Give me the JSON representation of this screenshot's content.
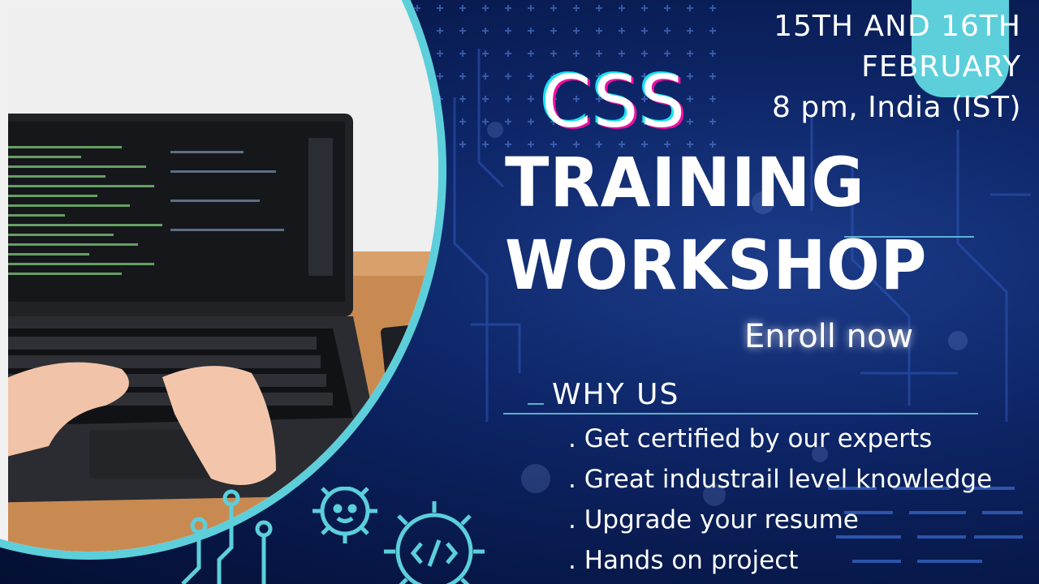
{
  "event": {
    "title_line1": "CSS",
    "title_line2": "TRAINING",
    "title_line3": "WORKSHOP"
  },
  "schedule": {
    "line1": "15TH AND 16TH",
    "line2": "FEBRUARY",
    "line3": "8 pm, India (IST)"
  },
  "cta": {
    "enroll_label": "Enroll now"
  },
  "why_us": {
    "heading": "WHY US",
    "items": [
      ". Get certified by our experts",
      ". Great industrail level knowledge",
      ". Upgrade your resume",
      ". Hands on project"
    ]
  },
  "colors": {
    "background": "#0d2566",
    "accent_teal": "#5ccfdb",
    "accent_magenta": "#f20fa4"
  },
  "icons": [
    "gear-code-icon",
    "gear-face-icon",
    "circuit-icon"
  ]
}
